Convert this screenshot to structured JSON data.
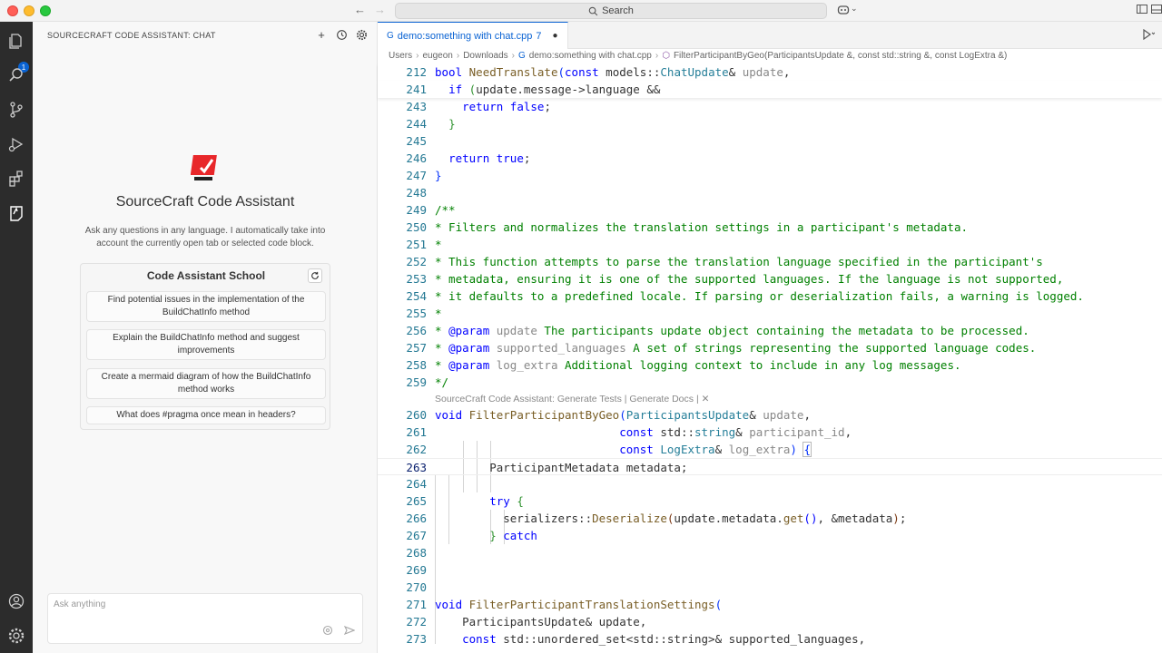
{
  "titlebar": {
    "search_placeholder": "Search",
    "account_label": "⌄"
  },
  "activity_bar": {
    "items": [
      "explorer-icon",
      "search-icon",
      "source-control-icon",
      "run-debug-icon",
      "extensions-icon",
      "assistant-icon"
    ],
    "bottom": [
      "account-icon",
      "settings-icon"
    ],
    "badge": "1"
  },
  "sidebar": {
    "header": "SOURCECRAFT CODE ASSISTANT: CHAT",
    "title": "SourceCraft Code Assistant",
    "description": "Ask any questions in any language. I automatically take into account the currently open tab or selected code block.",
    "school_title": "Code Assistant School",
    "suggestions": [
      "Find potential issues in the implementation of the BuildChatInfo method",
      "Explain the BuildChatInfo method and suggest improvements",
      "Create a mermaid diagram of how the BuildChatInfo method works",
      "What does #pragma once mean in headers?"
    ],
    "input_placeholder": "Ask anything"
  },
  "editor": {
    "tab": {
      "name": "demo:something with chat.cpp",
      "problems": "7",
      "dirty": "●"
    },
    "breadcrumb": [
      "Users",
      "eugeon",
      "Downloads",
      "demo:something with chat.cpp",
      "FilterParticipantByGeo(ParticipantsUpdate &, const std::string &, const LogExtra &)"
    ],
    "codelens": {
      "prefix": "SourceCraft Code Assistant: ",
      "generate_tests": "Generate Tests",
      "separator": " | ",
      "generate_docs": "Generate Docs",
      "close": " | ✕"
    },
    "line_numbers": [
      "212",
      "241",
      "243",
      "244",
      "245",
      "246",
      "247",
      "248",
      "249",
      "250",
      "251",
      "252",
      "253",
      "254",
      "255",
      "256",
      "257",
      "258",
      "259",
      "260",
      "261",
      "262",
      "263",
      "264",
      "265",
      "266",
      "267",
      "268",
      "269",
      "270",
      "271",
      "272",
      "273"
    ]
  }
}
